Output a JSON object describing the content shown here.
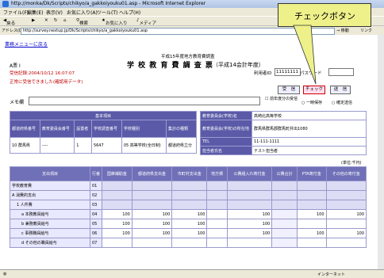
{
  "window": {
    "title": "http://monka/Dk/Scripts/chikyo/a_gakkoiyouku01.asp - Microsoft Internet Explorer"
  },
  "menu": [
    "ファイル(F)",
    "編集(E)",
    "表示(V)",
    "お気に入り(A)",
    "ツール(T)",
    "ヘルプ(H)"
  ],
  "toolbar": {
    "back": "戻る",
    "search": "検索",
    "favorites": "お気に入り",
    "media": "メディア"
  },
  "address": {
    "label": "アドレス(D)",
    "url": "http://survey.nextup.jp/Dk/Scripts/chikyo/a_gakkoiyouku01.asp",
    "go": "移動",
    "links": "リンク"
  },
  "callout": "チェックボタン",
  "page": {
    "back_link": "業務メニューに戻る",
    "grade": "A票 Ⅰ",
    "header_small": "平成15年度地方教育費調査",
    "title": "学 校 教 育 費 調 査 票",
    "title_sub": "（平成14会計年度）",
    "user_id_label": "利用者ID",
    "user_id": "11111111",
    "password_label": "パスワード",
    "password": "",
    "received": "受信記録:2004/10/12 16:07:07",
    "received_note": "正常に受信できました(確認用データ)",
    "buttons": {
      "receive": "受　信",
      "check": "チェック",
      "send": "送　信"
    },
    "memo_label": "メモ欄",
    "memo": "",
    "options": [
      "前年度分の受信",
      "一時保存",
      "確定送信"
    ],
    "info": {
      "school_label": "教育委員会(学校)名",
      "school": "高崎北高等学校",
      "addr_label": "教育委員会(学校)の所在地",
      "addr": "群馬県群馬郡群馬町井出1080",
      "tel_label": "TEL",
      "tel": "11-111-1111",
      "person_label": "担当者氏名",
      "person": "テスト担当者"
    },
    "basic": {
      "section": "基本項目",
      "headers": [
        "都道府県番号",
        "教育委員会番号",
        "設置者",
        "学校調査番号",
        "学校種別",
        "集計の種類"
      ],
      "values": [
        "10 群馬県",
        "----",
        "1",
        "5647",
        "05 高等学校(全日制)",
        "都道府県立分"
      ]
    },
    "unit": "(単位:千円)",
    "ledger": {
      "headers": [
        "支出項目",
        "行番",
        "国庫補助金",
        "都道府県支出金",
        "市町村支出金",
        "地方債",
        "公費組入れ寄付金",
        "公費合計",
        "PTA寄付金",
        "その他の寄付金"
      ],
      "rows": [
        {
          "label": "学校教育費",
          "code": "01",
          "values": [
            "",
            "",
            "",
            "",
            "",
            "",
            "",
            ""
          ]
        },
        {
          "label": "A 消費的支出",
          "code": "02",
          "values": [
            "",
            "",
            "",
            "",
            "",
            "",
            "",
            ""
          ]
        },
        {
          "label": "1 人件費",
          "code": "03",
          "values": [
            "",
            "",
            "",
            "",
            "",
            "",
            "",
            ""
          ]
        },
        {
          "label": "a 本務教員給与",
          "code": "04",
          "values": [
            "100",
            "100",
            "100",
            "",
            "100",
            "",
            "100",
            "100"
          ]
        },
        {
          "label": "b 兼務教員給与",
          "code": "05",
          "values": [
            "100",
            "100",
            "100",
            "",
            "100",
            "",
            "",
            ""
          ]
        },
        {
          "label": "c 事務職員給与",
          "code": "06",
          "values": [
            "100",
            "100",
            "100",
            "",
            "100",
            "",
            "100",
            "100"
          ]
        },
        {
          "label": "d その他の職員給与",
          "code": "07",
          "values": [
            "",
            "",
            "",
            "",
            "",
            "",
            "",
            ""
          ]
        }
      ]
    }
  },
  "status": {
    "internet": "インターネット"
  }
}
